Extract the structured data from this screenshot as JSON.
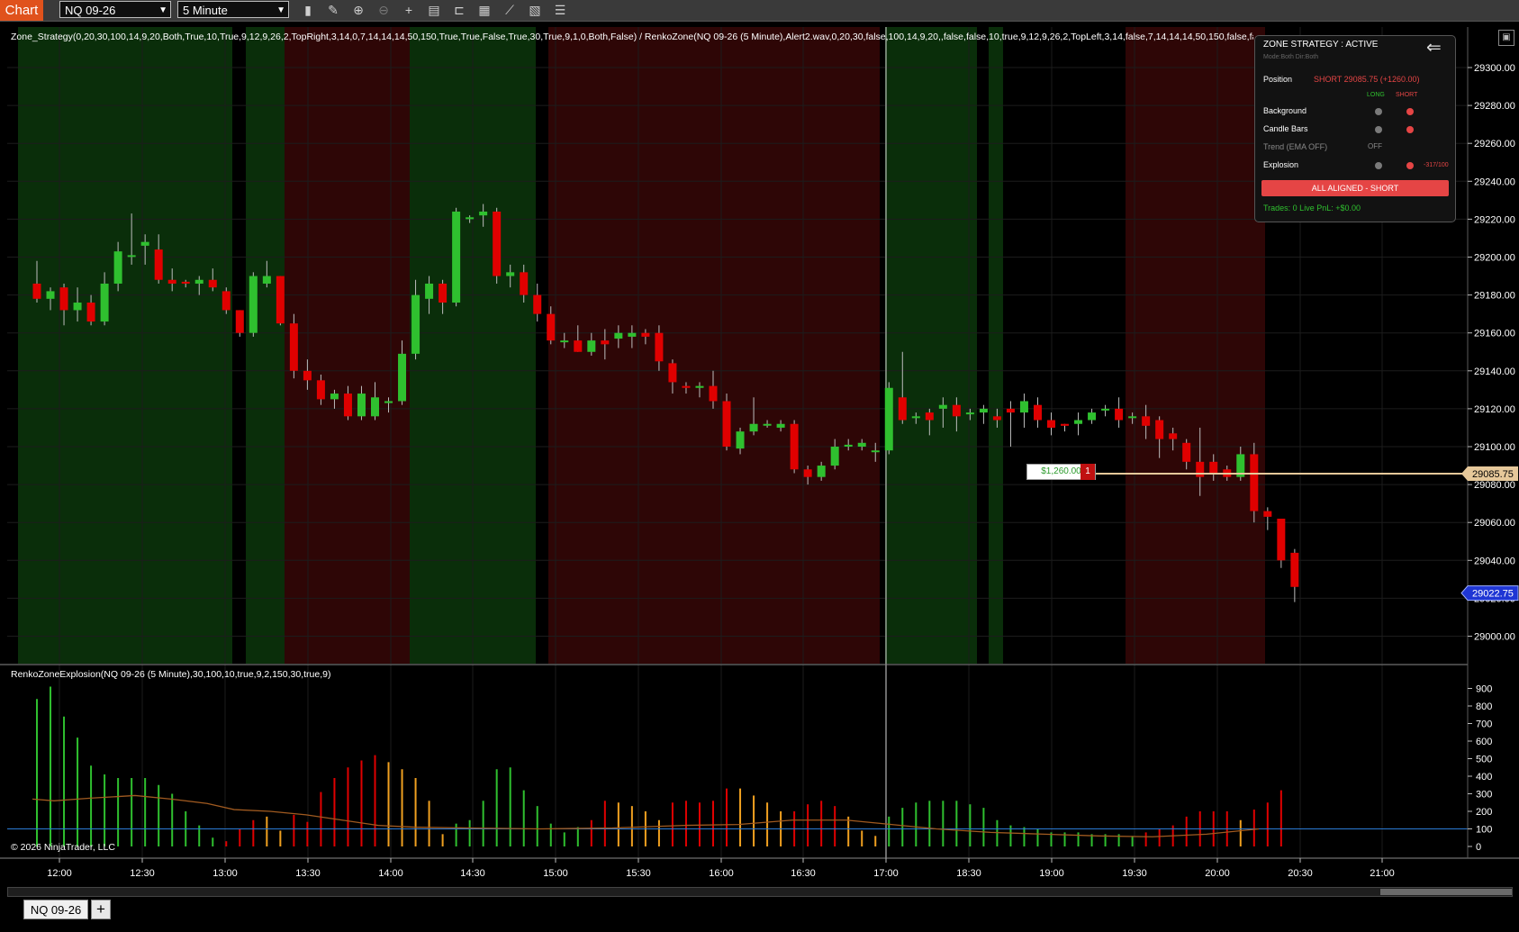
{
  "toolbar": {
    "chart_label": "Chart",
    "instrument": "NQ 09-26",
    "interval": "5 Minute",
    "icons": [
      "bars-type-icon",
      "draw-pencil-icon",
      "zoom-in-icon",
      "zoom-out-icon",
      "crosshair-icon",
      "data-box-icon",
      "bar-spacing-icon",
      "indicators-icon",
      "strategies-icon",
      "properties-icon",
      "menu-list-icon"
    ]
  },
  "main_panel": {
    "indicator_label": "Zone_Strategy(0,20,30,100,14,9,20,Both,True,10,True,9,12,9,26,2,TopRight,3,14,0,7,14,14,14,50,150,True,True,False,True,30,True,9,1,0,Both,False) / RenkoZone(NQ 09-26 (5 Minute),Alert2.wav,0,20,30,false,100,14,9,20,,false,false,10,true,9,12,9,26,2,TopLeft,3,14,false,7,14,14,14,50,150,false,false,false,false,30,true,9,1)",
    "price_ticks": [
      "29300.00",
      "29280.00",
      "29260.00",
      "29240.00",
      "29220.00",
      "29200.00",
      "29180.00",
      "29160.00",
      "29140.00",
      "29120.00",
      "29100.00",
      "29080.00",
      "29060.00",
      "29040.00",
      "29020.00",
      "29000.00"
    ],
    "position_line_price": "29085.75",
    "last_price": "29022.75",
    "pnl_label": "$1,260.00",
    "position_qty": "1"
  },
  "sub_panel": {
    "indicator_label": "RenkoZoneExplosion(NQ 09-26 (5 Minute),30,100,10,true,9,2,150,30,true,9)",
    "ticks": [
      "900",
      "800",
      "700",
      "600",
      "500",
      "400",
      "300",
      "200",
      "100",
      "0"
    ],
    "copyright": "© 2026 NinjaTrader, LLC"
  },
  "time_axis": [
    "12:00",
    "12:30",
    "13:00",
    "13:30",
    "14:00",
    "14:30",
    "15:00",
    "15:30",
    "16:00",
    "16:30",
    "17:00",
    "18:30",
    "19:00",
    "19:30",
    "20:00",
    "20:30",
    "21:00"
  ],
  "status_panel": {
    "title": "ZONE STRATEGY : ACTIVE",
    "mode_text": "Mode:Both  Dir:Both",
    "position_label": "Position",
    "position_value": "SHORT 29085.75  (+1260.00)",
    "col_long": "LONG",
    "col_short": "SHORT",
    "rows": [
      {
        "label": "Background",
        "long": "#7a7a7a",
        "short": "#e54545",
        "extra": ""
      },
      {
        "label": "Candle Bars",
        "long": "#7a7a7a",
        "short": "#e54545",
        "extra": ""
      },
      {
        "label": "Trend (EMA OFF)",
        "long": "",
        "short": "",
        "extra": "OFF"
      },
      {
        "label": "Explosion",
        "long": "#7a7a7a",
        "short": "#e54545",
        "extra": "-317/100"
      }
    ],
    "aligned_label": "ALL ALIGNED - SHORT",
    "trades_label": "Trades: 0    Live PnL: +$0.00"
  },
  "tabs": {
    "active": "NQ 09-26",
    "add_label": "+"
  },
  "colors": {
    "up": "#2fc02f",
    "down": "#e00000",
    "long_zone": "#0a2e0a",
    "short_zone": "#2e0606",
    "position_line": "#e6c89a",
    "last_price": "#1f36d4",
    "orange": "#f0a020"
  },
  "chart_data": {
    "type": "candlestick",
    "y_range": [
      28988,
      29309
    ],
    "candles": [
      [
        0,
        29186,
        29178,
        29198,
        29176
      ],
      [
        1,
        29178,
        29182,
        29184,
        29172
      ],
      [
        2,
        29184,
        29172,
        29186,
        29164
      ],
      [
        3,
        29172,
        29176,
        29184,
        29166
      ],
      [
        4,
        29176,
        29166,
        29180,
        29164
      ],
      [
        5,
        29166,
        29186,
        29192,
        29164
      ],
      [
        6,
        29186,
        29203,
        29208,
        29182
      ],
      [
        7,
        29201,
        29201,
        29223,
        29196
      ],
      [
        8,
        29206,
        29208,
        29212,
        29196
      ],
      [
        9,
        29204,
        29188,
        29212,
        29186
      ],
      [
        10,
        29188,
        29186,
        29194,
        29182
      ],
      [
        11,
        29187,
        29186,
        29188,
        29184
      ],
      [
        12,
        29186,
        29188,
        29190,
        29180
      ],
      [
        13,
        29188,
        29184,
        29194,
        29182
      ],
      [
        14,
        29182,
        29172,
        29184,
        29170
      ],
      [
        15,
        29172,
        29160,
        29172,
        29158
      ],
      [
        16,
        29160,
        29190,
        29192,
        29158
      ],
      [
        17,
        29186,
        29190,
        29198,
        29184
      ],
      [
        18,
        29190,
        29165,
        29190,
        29164
      ],
      [
        19,
        29165,
        29140,
        29170,
        29136
      ],
      [
        20,
        29140,
        29135,
        29146,
        29130
      ],
      [
        21,
        29135,
        29125,
        29138,
        29122
      ],
      [
        22,
        29125,
        29128,
        29130,
        29120
      ],
      [
        23,
        29128,
        29116,
        29132,
        29114
      ],
      [
        24,
        29116,
        29128,
        29132,
        29114
      ],
      [
        25,
        29116,
        29126,
        29134,
        29114
      ],
      [
        26,
        29123,
        29124,
        29126,
        29118
      ],
      [
        27,
        29124,
        29149,
        29156,
        29122
      ],
      [
        28,
        29149,
        29180,
        29188,
        29146
      ],
      [
        29,
        29178,
        29186,
        29190,
        29170
      ],
      [
        30,
        29186,
        29176,
        29188,
        29170
      ],
      [
        31,
        29176,
        29224,
        29226,
        29174
      ],
      [
        32,
        29220,
        29221,
        29222,
        29218
      ],
      [
        33,
        29222,
        29224,
        29228,
        29216
      ],
      [
        34,
        29224,
        29190,
        29226,
        29186
      ],
      [
        35,
        29190,
        29192,
        29196,
        29184
      ],
      [
        36,
        29192,
        29180,
        29196,
        29176
      ],
      [
        37,
        29180,
        29170,
        29186,
        29166
      ],
      [
        38,
        29170,
        29156,
        29174,
        29154
      ],
      [
        39,
        29156,
        29156,
        29160,
        29152
      ],
      [
        40,
        29156,
        29150,
        29164,
        29150
      ],
      [
        41,
        29150,
        29156,
        29160,
        29148
      ],
      [
        42,
        29156,
        29154,
        29162,
        29146
      ],
      [
        43,
        29157,
        29160,
        29164,
        29152
      ],
      [
        44,
        29158,
        29160,
        29164,
        29152
      ],
      [
        45,
        29160,
        29158,
        29162,
        29154
      ],
      [
        46,
        29160,
        29145,
        29164,
        29140
      ],
      [
        47,
        29144,
        29134,
        29146,
        29128
      ],
      [
        48,
        29132,
        29131,
        29134,
        29128
      ],
      [
        49,
        29131,
        29132,
        29134,
        29126
      ],
      [
        50,
        29132,
        29124,
        29140,
        29120
      ],
      [
        51,
        29124,
        29100,
        29128,
        29098
      ],
      [
        52,
        29099,
        29108,
        29110,
        29096
      ],
      [
        53,
        29108,
        29112,
        29126,
        29106
      ],
      [
        54,
        29112,
        29112,
        29114,
        29110
      ],
      [
        55,
        29110,
        29112,
        29114,
        29108
      ],
      [
        56,
        29112,
        29088,
        29114,
        29086
      ],
      [
        57,
        29088,
        29084,
        29090,
        29080
      ],
      [
        58,
        29084,
        29090,
        29092,
        29082
      ],
      [
        59,
        29090,
        29100,
        29104,
        29088
      ],
      [
        60,
        29100,
        29101,
        29104,
        29098
      ],
      [
        61,
        29100,
        29102,
        29104,
        29098
      ],
      [
        62,
        29098,
        29098,
        29102,
        29092
      ],
      [
        63,
        29098,
        29131,
        29134,
        29096
      ],
      [
        64,
        29126,
        29114,
        29150,
        29112
      ],
      [
        65,
        29116,
        29116,
        29118,
        29112
      ],
      [
        66,
        29118,
        29114,
        29120,
        29106
      ],
      [
        67,
        29120,
        29122,
        29126,
        29110
      ],
      [
        68,
        29122,
        29116,
        29126,
        29108
      ],
      [
        69,
        29118,
        29118,
        29120,
        29114
      ],
      [
        70,
        29118,
        29120,
        29122,
        29112
      ],
      [
        71,
        29116,
        29114,
        29120,
        29110
      ],
      [
        72,
        29120,
        29118,
        29124,
        29100
      ],
      [
        73,
        29118,
        29124,
        29128,
        29110
      ],
      [
        74,
        29122,
        29114,
        29126,
        29110
      ],
      [
        75,
        29114,
        29110,
        29118,
        29106
      ],
      [
        76,
        29112,
        29111,
        29112,
        29108
      ],
      [
        77,
        29112,
        29114,
        29118,
        29106
      ],
      [
        78,
        29114,
        29118,
        29120,
        29112
      ],
      [
        79,
        29120,
        29120,
        29122,
        29116
      ],
      [
        80,
        29120,
        29114,
        29126,
        29110
      ],
      [
        81,
        29116,
        29116,
        29118,
        29112
      ],
      [
        82,
        29116,
        29111,
        29122,
        29104
      ],
      [
        83,
        29114,
        29104,
        29116,
        29094
      ],
      [
        84,
        29107,
        29104,
        29110,
        29098
      ],
      [
        85,
        29102,
        29092,
        29104,
        29088
      ],
      [
        86,
        29092,
        29084,
        29110,
        29074
      ],
      [
        87,
        29092,
        29086,
        29096,
        29082
      ],
      [
        88,
        29088,
        29084,
        29090,
        29082
      ],
      [
        89,
        29084,
        29096,
        29100,
        29082
      ],
      [
        90,
        29096,
        29066,
        29102,
        29060
      ],
      [
        91,
        29066,
        29063,
        29068,
        29056
      ],
      [
        92,
        29062,
        29040,
        29062,
        29036
      ],
      [
        93,
        29044,
        29026,
        29046,
        29018
      ]
    ],
    "explosion": [
      [
        0,
        840,
        "g"
      ],
      [
        1,
        910,
        "g"
      ],
      [
        2,
        740,
        "g"
      ],
      [
        3,
        620,
        "g"
      ],
      [
        4,
        460,
        "g"
      ],
      [
        5,
        410,
        "g"
      ],
      [
        6,
        390,
        "g"
      ],
      [
        7,
        390,
        "g"
      ],
      [
        8,
        390,
        "g"
      ],
      [
        9,
        350,
        "g"
      ],
      [
        10,
        300,
        "g"
      ],
      [
        11,
        200,
        "g"
      ],
      [
        12,
        120,
        "g"
      ],
      [
        13,
        50,
        "g"
      ],
      [
        14,
        30,
        "r"
      ],
      [
        15,
        100,
        "r"
      ],
      [
        16,
        150,
        "r"
      ],
      [
        17,
        170,
        "o"
      ],
      [
        18,
        90,
        "o"
      ],
      [
        19,
        180,
        "r"
      ],
      [
        20,
        140,
        "r"
      ],
      [
        21,
        310,
        "r"
      ],
      [
        22,
        390,
        "r"
      ],
      [
        23,
        450,
        "r"
      ],
      [
        24,
        490,
        "r"
      ],
      [
        25,
        520,
        "r"
      ],
      [
        26,
        480,
        "o"
      ],
      [
        27,
        440,
        "o"
      ],
      [
        28,
        390,
        "o"
      ],
      [
        29,
        260,
        "o"
      ],
      [
        30,
        70,
        "o"
      ],
      [
        31,
        130,
        "g"
      ],
      [
        32,
        150,
        "g"
      ],
      [
        33,
        260,
        "g"
      ],
      [
        34,
        440,
        "g"
      ],
      [
        35,
        450,
        "g"
      ],
      [
        36,
        320,
        "g"
      ],
      [
        37,
        230,
        "g"
      ],
      [
        38,
        130,
        "g"
      ],
      [
        39,
        80,
        "g"
      ],
      [
        40,
        110,
        "g"
      ],
      [
        41,
        150,
        "r"
      ],
      [
        42,
        260,
        "r"
      ],
      [
        43,
        250,
        "o"
      ],
      [
        44,
        230,
        "o"
      ],
      [
        45,
        200,
        "o"
      ],
      [
        46,
        150,
        "o"
      ],
      [
        47,
        250,
        "r"
      ],
      [
        48,
        260,
        "r"
      ],
      [
        49,
        250,
        "r"
      ],
      [
        50,
        260,
        "r"
      ],
      [
        51,
        330,
        "r"
      ],
      [
        52,
        330,
        "o"
      ],
      [
        53,
        290,
        "o"
      ],
      [
        54,
        250,
        "o"
      ],
      [
        55,
        200,
        "o"
      ],
      [
        56,
        200,
        "r"
      ],
      [
        57,
        240,
        "r"
      ],
      [
        58,
        260,
        "r"
      ],
      [
        59,
        230,
        "r"
      ],
      [
        60,
        170,
        "o"
      ],
      [
        61,
        90,
        "o"
      ],
      [
        62,
        60,
        "o"
      ],
      [
        63,
        170,
        "g"
      ],
      [
        64,
        220,
        "g"
      ],
      [
        65,
        250,
        "g"
      ],
      [
        66,
        260,
        "g"
      ],
      [
        67,
        260,
        "g"
      ],
      [
        68,
        260,
        "g"
      ],
      [
        69,
        240,
        "g"
      ],
      [
        70,
        220,
        "g"
      ],
      [
        71,
        150,
        "g"
      ],
      [
        72,
        120,
        "g"
      ],
      [
        73,
        110,
        "g"
      ],
      [
        74,
        100,
        "g"
      ],
      [
        75,
        80,
        "g"
      ],
      [
        76,
        80,
        "g"
      ],
      [
        77,
        80,
        "g"
      ],
      [
        78,
        70,
        "g"
      ],
      [
        79,
        70,
        "g"
      ],
      [
        80,
        70,
        "g"
      ],
      [
        81,
        60,
        "g"
      ],
      [
        82,
        80,
        "r"
      ],
      [
        83,
        100,
        "r"
      ],
      [
        84,
        120,
        "r"
      ],
      [
        85,
        170,
        "r"
      ],
      [
        86,
        200,
        "r"
      ],
      [
        87,
        200,
        "r"
      ],
      [
        88,
        200,
        "r"
      ],
      [
        89,
        150,
        "o"
      ],
      [
        90,
        210,
        "r"
      ],
      [
        91,
        250,
        "r"
      ],
      [
        92,
        320,
        "r"
      ]
    ]
  }
}
